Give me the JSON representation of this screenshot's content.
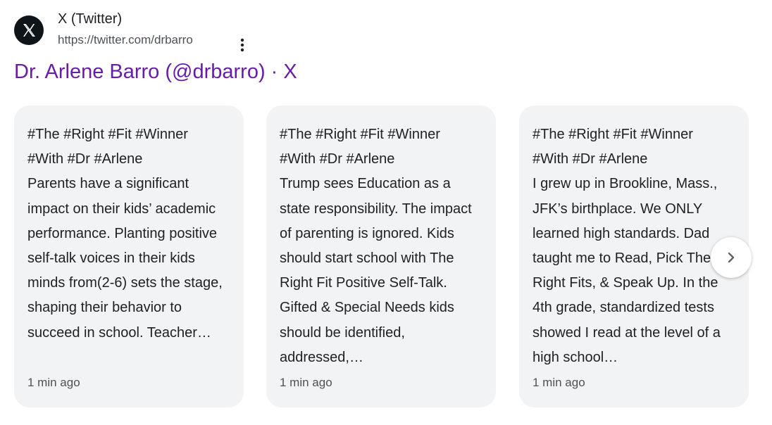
{
  "source": {
    "site_name": "X (Twitter)",
    "url": "https://twitter.com/drbarro",
    "favicon_icon": "x-logo-icon",
    "more_icon": "more-vert-icon"
  },
  "result": {
    "title": "Dr. Arlene Barro (@drbarro) · X"
  },
  "cards": [
    {
      "hashtags_line1": "#The #Right #Fit #Winner",
      "hashtags_line2": "#With #Dr #Arlene",
      "body": "Parents have a significant impact on their kids’ academic performance. Planting positive self-talk voices in their kids minds from(2-6) sets the stage, shaping their behavior to succeed in school. Teacher…",
      "time": "1 min ago"
    },
    {
      "hashtags_line1": "#The #Right #Fit #Winner",
      "hashtags_line2": "#With #Dr #Arlene",
      "body": "Trump sees Education as a state responsibility. The impact of parenting is ignored. Kids should start school with The Right Fit Positive Self-Talk. Gifted & Special Needs kids should be identified, addressed,…",
      "time": "1 min ago"
    },
    {
      "hashtags_line1": "#The #Right #Fit #Winner",
      "hashtags_line2": "#With #Dr #Arlene",
      "body": "I grew up in Brookline, Mass., JFK’s birthplace. We ONLY learned high standards. Dad taught me to Read, Pick The Right Fits, & Speak Up. In the 4th grade, standardized tests showed I read at the level of a high school…",
      "time": "1 min ago"
    }
  ],
  "carousel": {
    "next_icon": "chevron-right-icon"
  },
  "colors": {
    "title_link": "#681da8",
    "card_background": "#f1f3f4",
    "favicon_background": "#0f1419"
  }
}
